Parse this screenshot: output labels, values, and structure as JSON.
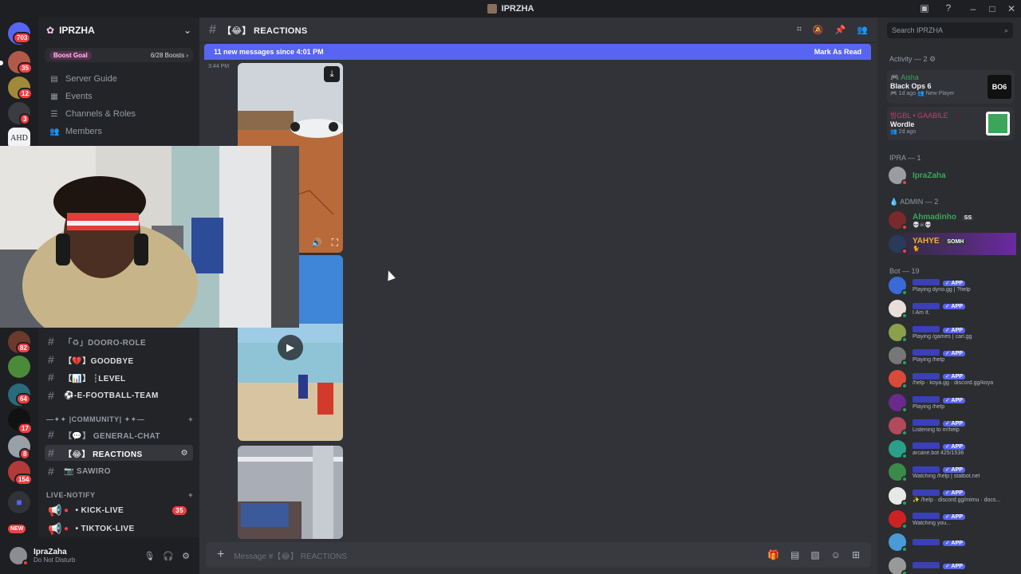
{
  "window": {
    "title": "IPRZHA"
  },
  "guild": {
    "name": "IPRZHA",
    "boost_goal": "Boost Goal",
    "boost_count": "6/28 Boosts"
  },
  "nav": [
    {
      "label": "Server Guide"
    },
    {
      "label": "Events"
    },
    {
      "label": "Channels & Roles"
    },
    {
      "label": "Members"
    }
  ],
  "rail_badges": [
    "703",
    "35",
    "12",
    "3",
    "82",
    "64",
    "17",
    "8",
    "154"
  ],
  "rail_labels": {
    "ahd": "AHD",
    "new": "NEW"
  },
  "channels": {
    "dooro": "「♻」DOORO-ROLE",
    "goodbye": "【💔】GOODBYE",
    "level": "【📊】 ┆LEVEL",
    "efootball": "⚽-E-FOOTBALL-TEAM",
    "cat_community": "—✦✦ |COMMUNITY| ✦✦—",
    "general": "【💬】 GENERAL-CHAT",
    "reactions": "【😂】 REACTIONS",
    "sawiro": "📷 SAWIRO",
    "cat_live": "LIVE-NOTIFY",
    "kick": "• KICK-LIVE",
    "kick_count": "35",
    "tiktok": "• TIKTOK-LIVE"
  },
  "user": {
    "name": "IpraZaha",
    "status": "Do Not Disturb"
  },
  "channel_header": {
    "name": "【😂】 REACTIONS"
  },
  "new_messages": {
    "text": "11 new messages since 4:01 PM",
    "action": "Mark As Read"
  },
  "message": {
    "time": "3:44 PM"
  },
  "composer": {
    "placeholder": "Message #【😂】 REACTIONS"
  },
  "search": {
    "placeholder": "Search IPRZHA"
  },
  "activity": {
    "title": "Activity — 2",
    "items": [
      {
        "user": "Aisha",
        "game": "Black Ops 6",
        "meta": "1d ago",
        "meta2": "New Player",
        "logo": "BO6"
      },
      {
        "user": "빙GBL • GAABILE",
        "game": "Wordle",
        "meta": "2d ago",
        "meta2": "",
        "logo": ""
      }
    ]
  },
  "sections": {
    "ipra": "IPRA — 1",
    "admin": "ADMIN — 2",
    "bot": "Bot — 19"
  },
  "members": {
    "owner": {
      "name": "IpraZaha"
    },
    "admins": [
      {
        "name": "Ahmadinho",
        "tag": "SS",
        "sub": "💀☠💀"
      },
      {
        "name": "YAHYE",
        "tag": "SOMH",
        "sub": "🐈"
      }
    ],
    "app_label": "APP",
    "bots": [
      {
        "sub": "Playing dyno.gg | ?help"
      },
      {
        "sub": "I Am It."
      },
      {
        "sub": "Playing /games | carl.gg"
      },
      {
        "sub": "Playing /help"
      },
      {
        "sub": "/help · koya.gg · discord.gg/koya"
      },
      {
        "sub": "Playing /help"
      },
      {
        "sub": "Listening to m!help"
      },
      {
        "sub": "arcane.bot 425/1536"
      },
      {
        "sub": "Watching /help | statbot.net"
      },
      {
        "sub": "✨ /help · discord.gg/mimu · docs..."
      },
      {
        "sub": "Watching you..."
      },
      {
        "sub": ""
      },
      {
        "sub": ""
      }
    ]
  },
  "colors": {
    "accent": "#5865f2",
    "dnd": "#f23f43",
    "online": "#23a55a",
    "admin_green": "#3ba55c",
    "yahye_yellow": "#f0b232"
  }
}
